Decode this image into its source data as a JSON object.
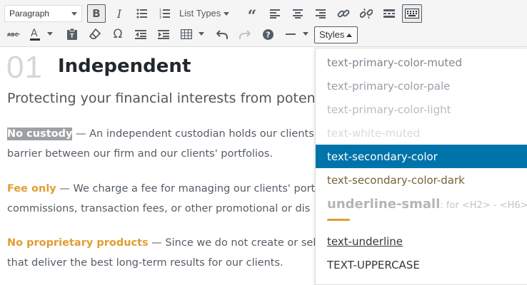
{
  "toolbar": {
    "format_select": "Paragraph",
    "list_types_label": "List Types",
    "styles_label": "Styles"
  },
  "content": {
    "section_number": "01",
    "section_title": "Independent",
    "section_subtitle": "Protecting your financial interests from potent",
    "paragraphs": [
      {
        "lead": "No custody",
        "line1": " — An independent custodian holds our clients'",
        "line2": "barrier between our firm and our clients' portfolios."
      },
      {
        "lead": "Fee only",
        "line1": " — We charge a fee for managing our clients' portfo",
        "line2": "commissions, transaction fees, or other promotional or dis"
      },
      {
        "lead": "No proprietary products",
        "line1": " — Since we do not create or sell p",
        "line2": "that deliver the best long-term results for our clients."
      }
    ]
  },
  "styles_menu": {
    "items": [
      {
        "label": "text-primary-color-muted",
        "color": "#7e8791"
      },
      {
        "label": "text-primary-color-pale",
        "color": "#99a0a8"
      },
      {
        "label": "text-primary-color-light",
        "color": "#b6bcc4"
      },
      {
        "label": "text-white-muted",
        "color": "#dadada"
      },
      {
        "label": "text-secondary-color",
        "color": "#ffffff",
        "selected": true
      },
      {
        "label": "text-secondary-color-dark",
        "color": "#7a6136"
      }
    ],
    "underline_small_label": "underline-small",
    "underline_small_hint": ": for <H2> - <H6>",
    "text_underline_label": "text-underline",
    "text_uppercase_label": "TEXT-UPPERCASE"
  },
  "colors": {
    "accent": "#e19d33",
    "selected_bg": "#0073aa",
    "highlight_bg": "#9ea1a4"
  },
  "icons": [
    "bold-icon",
    "italic-icon",
    "bullet-list-icon",
    "numbered-list-icon",
    "blockquote-icon",
    "align-left-icon",
    "align-center-icon",
    "align-right-icon",
    "link-icon",
    "unlink-icon",
    "read-more-icon",
    "toolbar-toggle-icon",
    "strikethrough-icon",
    "text-color-icon",
    "paste-text-icon",
    "clear-formatting-icon",
    "special-character-icon",
    "outdent-icon",
    "indent-icon",
    "table-icon",
    "undo-icon",
    "redo-icon",
    "help-icon",
    "horizontal-line-icon"
  ]
}
